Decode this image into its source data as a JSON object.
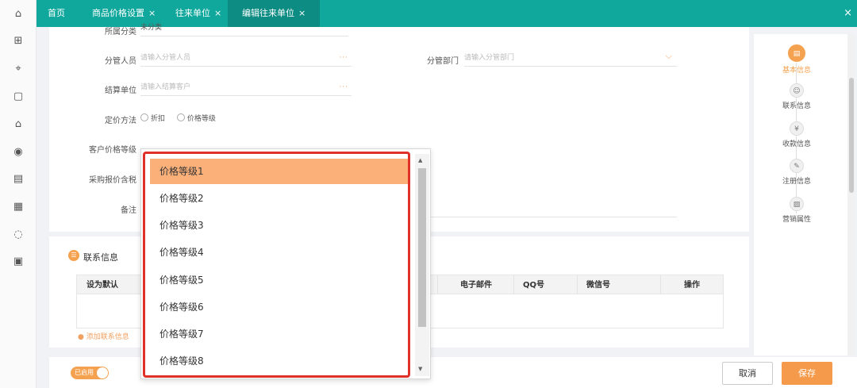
{
  "tabs": [
    {
      "label": "首页"
    },
    {
      "label": "商品价格设置",
      "close": "×"
    },
    {
      "label": "往来单位",
      "close": "×"
    },
    {
      "label": "编辑往来单位",
      "close": "×"
    }
  ],
  "close_all": "×",
  "form": {
    "category": {
      "label": "所属分类",
      "value": "未分类"
    },
    "manager": {
      "label": "分管人员",
      "placeholder": "请输入分管人员",
      "dots": "···"
    },
    "department": {
      "label": "分管部门",
      "placeholder": "请输入分管部门"
    },
    "settle": {
      "label": "结算单位",
      "placeholder": "请输入结算客户",
      "dots": "···"
    },
    "pricing": {
      "label": "定价方法",
      "options": [
        "折扣",
        "价格等级"
      ]
    },
    "price_level": {
      "label": "客户价格等级"
    },
    "purchase_tax": {
      "label": "采购报价含税"
    },
    "remark": {
      "label": "备注"
    }
  },
  "contact": {
    "title": "联系信息",
    "columns": [
      "设为默认",
      "电子邮件",
      "QQ号",
      "微信号",
      "操作"
    ],
    "add": "添加联系信息"
  },
  "right_nav": [
    {
      "label": "基本信息",
      "icon": "document-icon"
    },
    {
      "label": "联系信息",
      "icon": "contact-icon"
    },
    {
      "label": "收款信息",
      "icon": "payment-icon"
    },
    {
      "label": "注册信息",
      "icon": "edit-icon"
    },
    {
      "label": "营销属性",
      "icon": "chart-icon"
    }
  ],
  "bottom": {
    "toggle": "已启用",
    "cancel": "取消",
    "save": "保存"
  },
  "dropdown": {
    "options": [
      "价格等级1",
      "价格等级2",
      "价格等级3",
      "价格等级4",
      "价格等级5",
      "价格等级6",
      "价格等级7",
      "价格等级8"
    ],
    "selected": "价格等级1"
  },
  "colors": {
    "accent": "#10a89c",
    "orange": "#f5a250",
    "highlight": "#e0302a"
  }
}
